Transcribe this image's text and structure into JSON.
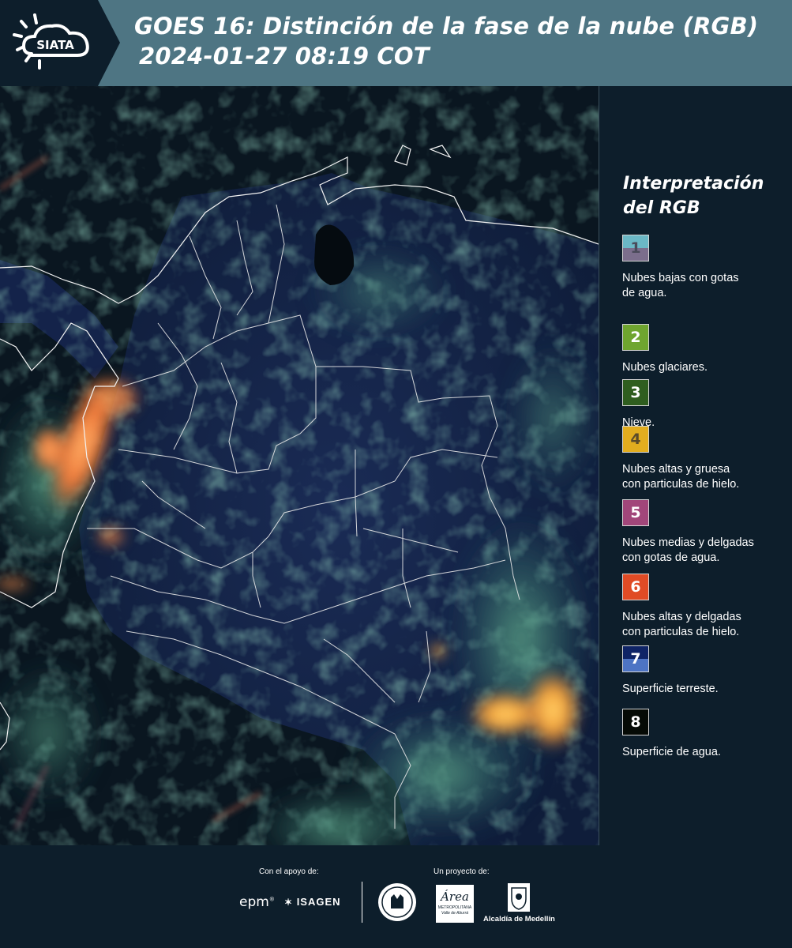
{
  "header": {
    "title_line1": "GOES 16: Distinción de la fase de la nube (RGB)",
    "title_line2": "2024-01-27 08:19 COT",
    "logo_text": "SIATA",
    "background_color": "#4e7583"
  },
  "legend": {
    "title_line1": "Interpretación",
    "title_line2": "del RGB",
    "items": [
      {
        "number": "1",
        "label_line1": "Nubes bajas con gotas",
        "label_line2": "de agua.",
        "color_top": "#6bb8c6",
        "color_bottom": "#7b6e8c",
        "number_color": "#4a4a5a"
      },
      {
        "number": "2",
        "label_line1": "Nubes glaciares.",
        "label_line2": "",
        "color_top": "#6fa52f",
        "color_bottom": "#6fa52f",
        "number_color": "#ffffff"
      },
      {
        "number": "3",
        "label_line1": "Nieve.",
        "label_line2": "",
        "color_top": "#2f5e1f",
        "color_bottom": "#2f5e1f",
        "number_color": "#ffffff"
      },
      {
        "number": "4",
        "label_line1": "Nubes altas y gruesa",
        "label_line2": "con particulas de hielo.",
        "color_top": "#e2ad1f",
        "color_bottom": "#e2ad1f",
        "number_color": "#5a4a2a"
      },
      {
        "number": "5",
        "label_line1": "Nubes medias y delgadas",
        "label_line2": "con gotas de agua.",
        "color_top": "#a1467a",
        "color_bottom": "#a1467a",
        "number_color": "#ffffff"
      },
      {
        "number": "6",
        "label_line1": "Nubes altas y delgadas",
        "label_line2": "con particulas de hielo.",
        "color_top": "#e04b25",
        "color_bottom": "#e04b25",
        "number_color": "#ffffff"
      },
      {
        "number": "7",
        "label_line1": "Superficie terreste.",
        "label_line2": "",
        "color_top": "#0f2466",
        "color_bottom": "#4d74c4",
        "number_color": "#ffffff"
      },
      {
        "number": "8",
        "label_line1": "Superficie de agua.",
        "label_line2": "",
        "color_top": "#050a05",
        "color_bottom": "#050a05",
        "number_color": "#ffffff"
      }
    ]
  },
  "footer": {
    "support_label": "Con el apoyo de:",
    "project_label": "Un proyecto de:",
    "sponsor_epm": "epm",
    "sponsor_isagen": "ISAGEN",
    "area_logo_text": "Área",
    "area_sub1": "METROPOLITANA",
    "area_sub2": "Valle de Aburrá",
    "alcaldia_label": "Alcaldía de Medellín"
  }
}
